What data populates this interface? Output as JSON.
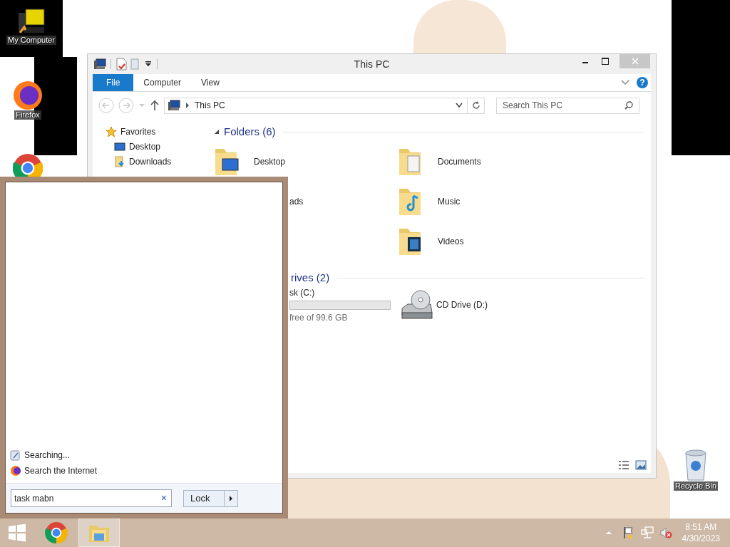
{
  "desktop_icons": [
    {
      "kind": "computer",
      "label": "My Computer"
    },
    {
      "kind": "firefox",
      "label": "Firefox"
    },
    {
      "kind": "chrome"
    },
    {
      "kind": "recycle",
      "label": "Recycle Bin"
    }
  ],
  "explorer": {
    "title": "This PC",
    "ribbon_tabs": [
      {
        "label": "File",
        "selected": true
      },
      {
        "label": "Computer",
        "selected": false
      },
      {
        "label": "View",
        "selected": false
      }
    ],
    "help_glyph": "?",
    "address": "This PC",
    "search_placeholder": "Search This PC",
    "nav": [
      {
        "label": "Favorites",
        "kind": "star",
        "children": [
          {
            "label": "Desktop",
            "kind": "desktop"
          },
          {
            "label": "Downloads",
            "kind": "downloads"
          }
        ]
      }
    ],
    "sections": [
      {
        "title": "Folders (6)",
        "columns": [
          [
            {
              "label": "Desktop",
              "kind": "desktop"
            },
            {
              "label": "ads",
              "kind": "hidden"
            }
          ],
          [
            {
              "label": "Documents",
              "kind": "documents"
            },
            {
              "label": "Music",
              "kind": "music"
            },
            {
              "label": "Videos",
              "kind": "videos"
            }
          ]
        ]
      },
      {
        "title": "rives (2)",
        "columns": [
          [
            {
              "label": "sk (C:)",
              "detail": "free of 99.6 GB",
              "kind": "disk"
            }
          ],
          [
            {
              "label": "CD Drive (D:)",
              "kind": "cd"
            }
          ]
        ]
      }
    ]
  },
  "start_menu": {
    "results": [
      {
        "label": "Searching...",
        "kind": "search"
      },
      {
        "label": "Search the Internet",
        "kind": "firefox"
      }
    ],
    "search_value": "task mabn",
    "clear_glyph": "×",
    "power_button": "Lock"
  },
  "taskbar": {
    "items": [
      {
        "kind": "chrome",
        "selected": false
      },
      {
        "kind": "explorer",
        "selected": true
      }
    ],
    "time": "8:51 AM",
    "date": "4/30/2023"
  }
}
